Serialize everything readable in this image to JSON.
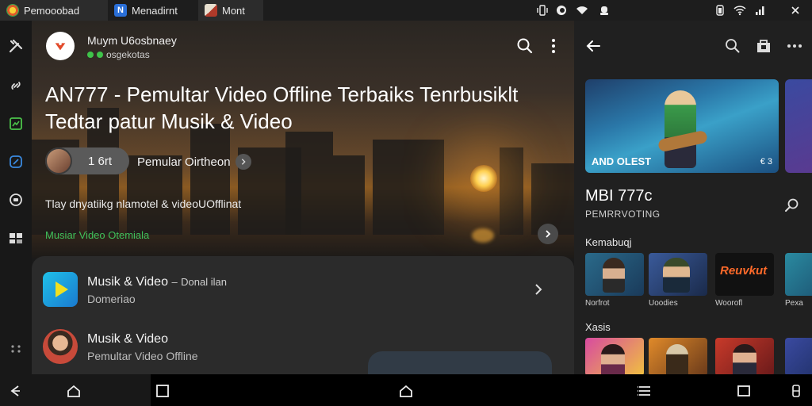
{
  "tabs": [
    {
      "label": "Pemooobad",
      "color": "#e05a2a",
      "active": true
    },
    {
      "label": "Menadirnt",
      "color": "#2a6fd8",
      "active": false
    },
    {
      "label": "Mont",
      "color": "#b03a2a",
      "active": true
    }
  ],
  "status_icons": [
    "vibrate-icon",
    "circle-icon",
    "wifi-icon",
    "alarm-icon",
    "battery-icon",
    "wifi-icon",
    "signal-icon",
    "close-icon"
  ],
  "rail": [
    "tools-icon",
    "link-icon",
    "news-icon",
    "compass-icon",
    "record-icon",
    "gallery-icon",
    "grid-dots-icon"
  ],
  "main": {
    "channel_name": "Muym U6osbnaey",
    "channel_sub": "osgekotas",
    "title_line1": "AN777 - Pemultar Video Offline Terbaiks Tenrbusiklt",
    "title_line2": "Tedtar patur Musik & Video",
    "view_count": "1 6rt",
    "uploader": "Pemular Oirtheon",
    "description": "Tlay dnyatiikg nlamotel & videoUOfflinat",
    "tags": "Musiar Video Otemiala",
    "list": [
      {
        "title": "Musik & Video",
        "extra": "Donal ilan",
        "subtitle": "Domeriao",
        "icon_color": "#1aa8e0"
      },
      {
        "title": "Musik & Video",
        "extra": "",
        "subtitle": "Pemultar Video Offline",
        "icon_color": "#c88a6a"
      }
    ]
  },
  "right": {
    "banner_title": "AND OLEST",
    "banner_badge": "€ 3",
    "app_name": "MBI 777c",
    "app_sub": "PEMRRVOTING",
    "section1": "Kemabuqj",
    "section1_items": [
      {
        "label": "Norfrot",
        "color1": "#2a6a8a",
        "color2": "#1a3a5a"
      },
      {
        "label": "Uoodies",
        "color1": "#3a5a9a",
        "color2": "#1a2a4a"
      },
      {
        "label": "Woorofl",
        "color1": "#1a1a1a",
        "color2": "#2a1a1a",
        "text": "Reuvkut"
      },
      {
        "label": "Pexa",
        "color1": "#2a8aa0",
        "color2": "#1a4a6a"
      }
    ],
    "section2": "Xasis",
    "section2_items": [
      {
        "color1": "#d84aa0",
        "color2": "#f0c040"
      },
      {
        "color1": "#e08a2a",
        "color2": "#6a3a1a"
      },
      {
        "color1": "#c83a2a",
        "color2": "#6a1a1a"
      },
      {
        "color1": "#3a4aa0",
        "color2": "#1a2a5a"
      }
    ]
  },
  "bottom_nav": [
    "back-icon",
    "home-icon",
    "recents-icon",
    "home-icon",
    "menu-icon",
    "square-icon",
    "battery-icon"
  ]
}
